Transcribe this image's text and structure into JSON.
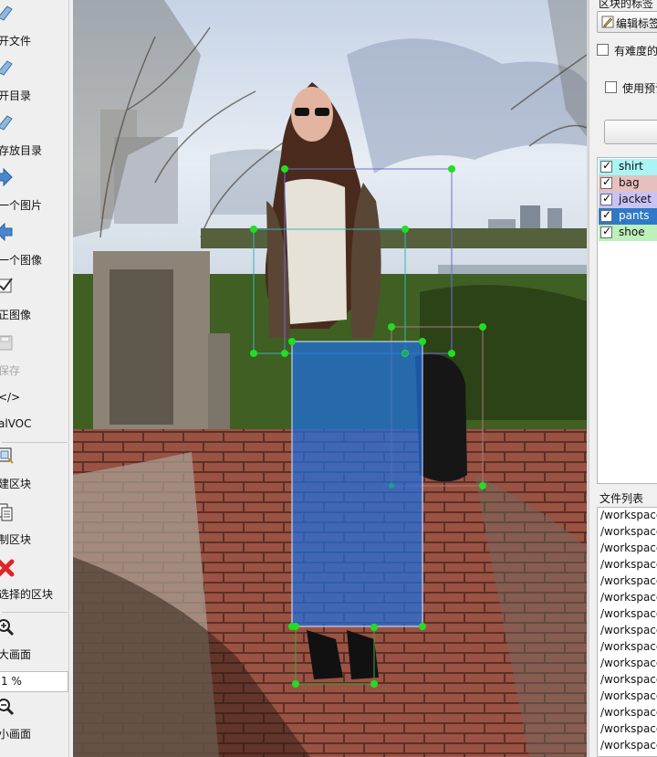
{
  "toolbar": {
    "items": [
      {
        "label": "开文件",
        "icon": "folder-open-icon",
        "enabled": true
      },
      {
        "label": "开目录",
        "icon": "folder-open-dir-icon",
        "enabled": true
      },
      {
        "label": "存放目录",
        "icon": "folder-save-dir-icon",
        "enabled": true
      },
      {
        "label": "一个图片",
        "icon": "arrow-right-icon",
        "enabled": true
      },
      {
        "label": "一个图像",
        "icon": "arrow-left-icon",
        "enabled": true
      },
      {
        "label": "正图像",
        "icon": "verify-check-icon",
        "enabled": true
      },
      {
        "label": "保存",
        "icon": "save-disk-icon",
        "enabled": false
      },
      {
        "label": "</>",
        "icon": "format-code-icon",
        "enabled": true
      },
      {
        "label": "alVOC",
        "icon": "",
        "enabled": true
      },
      {
        "label": "建区块",
        "icon": "create-box-icon",
        "enabled": true
      },
      {
        "label": "制区块",
        "icon": "copy-box-icon",
        "enabled": true
      },
      {
        "label": "选择的区块",
        "icon": "delete-x-icon",
        "enabled": true
      },
      {
        "label": "放大画面",
        "icon": "zoom-in-icon",
        "enabled": true
      },
      {
        "label": "缩小画面",
        "icon": "zoom-out-icon",
        "enabled": true
      }
    ],
    "zoom_value": "1 %",
    "zoom_in_label": "大画面",
    "zoom_out_label": "小画面"
  },
  "dock": {
    "section_title": "区块的标签",
    "edit_label_button": "编辑标签",
    "difficult_checkbox": "有难度的",
    "use_default_checkbox": "使用预设",
    "labels": [
      {
        "name": "shirt",
        "color": "#aaf4f3",
        "checked": true,
        "selected": false
      },
      {
        "name": "bag",
        "color": "#e6c0bd",
        "checked": true,
        "selected": false
      },
      {
        "name": "jacket",
        "color": "#c7c3f4",
        "checked": true,
        "selected": false
      },
      {
        "name": "pants",
        "color": "#2f79c7",
        "checked": true,
        "selected": true
      },
      {
        "name": "shoe",
        "color": "#bdf0bb",
        "checked": true,
        "selected": false
      }
    ],
    "file_list_title": "文件列表",
    "files": [
      "/workspace",
      "/workspace",
      "/workspace",
      "/workspace",
      "/workspace",
      "/workspace",
      "/workspace",
      "/workspace",
      "/workspace",
      "/workspace",
      "/workspace",
      "/workspace",
      "/workspace",
      "/workspace",
      "/workspace"
    ]
  },
  "canvas": {
    "boxes": [
      {
        "label": "jacket",
        "color": "#6f6fd0"
      },
      {
        "label": "shirt",
        "color": "#35b7b7"
      },
      {
        "label": "bag",
        "color": "#b07a76"
      },
      {
        "label": "pants",
        "color": "#1e6fe0"
      },
      {
        "label": "shoe",
        "color": "#3caa3c"
      }
    ],
    "vertex_color": "#22dd22"
  }
}
